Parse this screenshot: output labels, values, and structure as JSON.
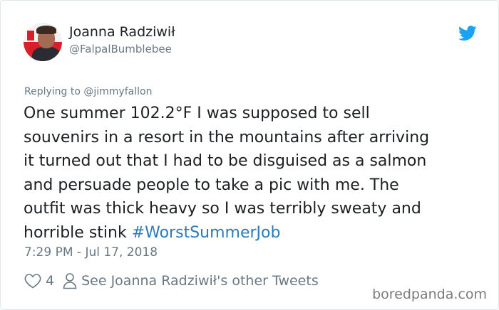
{
  "author": {
    "display_name": "Joanna Radziwił",
    "handle": "@FalpalBumblebee"
  },
  "tweet": {
    "reply_to": "Replying to @jimmyfallon",
    "text": "One summer 102.2°F I was supposed to sell\nsouvenirs in a resort in the mountains after arriving\nit turned out that I had to be disguised as a salmon\nand persuade people to take a pic with me. The\noutfit was thick heavy so I was terribly sweaty and\nhorrible stink ",
    "hashtag": "#WorstSummerJob",
    "timestamp": "7:29 PM - Jul 17, 2018"
  },
  "actions": {
    "like_count": "4",
    "other_tweets_label": "See Joanna Radziwił's other Tweets"
  },
  "watermark": "boredpanda.com",
  "icons": {
    "brand": "twitter-bird-icon",
    "like": "heart-icon",
    "profile": "person-icon"
  },
  "colors": {
    "twitter_blue": "#1da1f2",
    "hashtag": "#2b7bb9",
    "secondary_text": "#697882",
    "primary_text": "#1c2022"
  }
}
